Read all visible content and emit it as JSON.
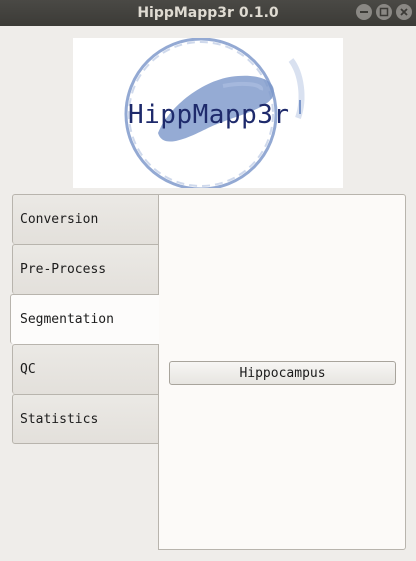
{
  "window": {
    "title": "HippMapp3r 0.1.0"
  },
  "logo": {
    "text": "HippMapp3r"
  },
  "tabs": [
    {
      "label": "Conversion",
      "active": false
    },
    {
      "label": "Pre-Process",
      "active": false
    },
    {
      "label": "Segmentation",
      "active": true
    },
    {
      "label": "QC",
      "active": false
    },
    {
      "label": "Statistics",
      "active": false
    }
  ],
  "panel": {
    "button_label": "Hippocampus"
  },
  "colors": {
    "titlebar": "#3c3b37",
    "background": "#efedea",
    "logo_text": "#1e2a6b",
    "logo_ring": "#6f8cc4"
  },
  "icons": [
    "minimize-icon",
    "maximize-icon",
    "close-icon"
  ]
}
